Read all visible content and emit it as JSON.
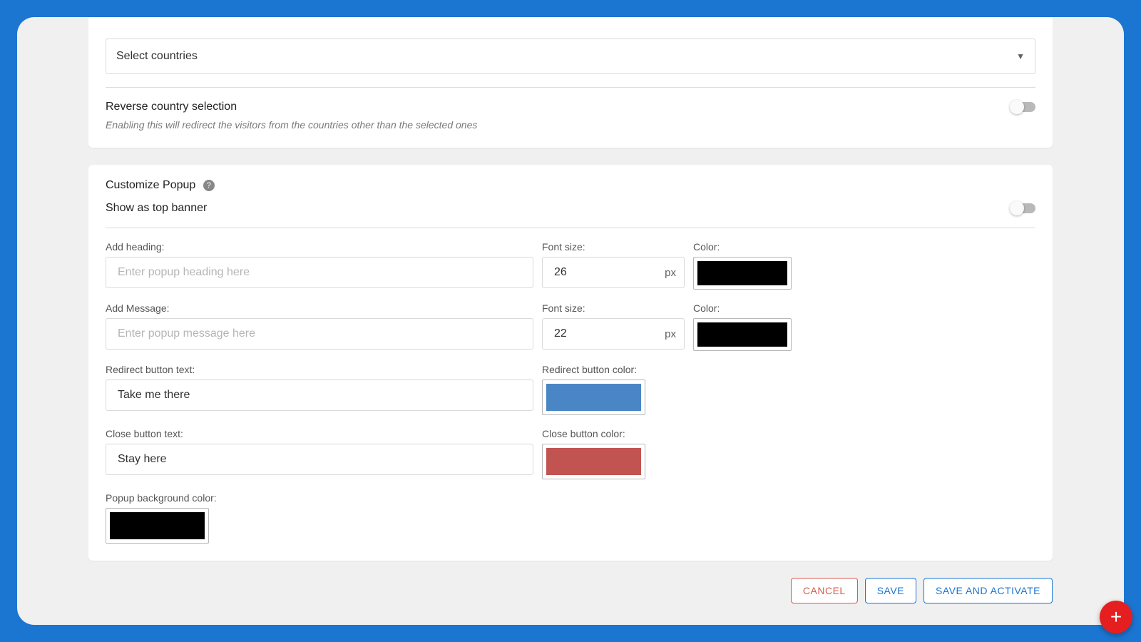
{
  "countrySelect": {
    "placeholder": "Select countries"
  },
  "reverse": {
    "title": "Reverse country selection",
    "hint": "Enabling this will redirect the visitors from the countries other than the selected ones"
  },
  "customize": {
    "title": "Customize Popup",
    "showTopBanner": "Show as top banner"
  },
  "fields": {
    "headingLabel": "Add heading:",
    "headingPlaceholder": "Enter popup heading here",
    "headingFontLabel": "Font size:",
    "headingFontValue": "26",
    "headingColorLabel": "Color:",
    "headingColor": "#000000",
    "messageLabel": "Add Message:",
    "messagePlaceholder": "Enter popup message here",
    "messageFontLabel": "Font size:",
    "messageFontValue": "22",
    "messageColorLabel": "Color:",
    "messageColor": "#000000",
    "redirectTextLabel": "Redirect button text:",
    "redirectTextValue": "Take me there",
    "redirectColorLabel": "Redirect button color:",
    "redirectColor": "#4a86c5",
    "closeTextLabel": "Close button text:",
    "closeTextValue": "Stay here",
    "closeColorLabel": "Close button color:",
    "closeColor": "#c15451",
    "popupBgLabel": "Popup background color:",
    "popupBgColor": "#000000",
    "pxSuffix": "px"
  },
  "buttons": {
    "cancel": "CANCEL",
    "save": "SAVE",
    "saveActivate": "SAVE AND ACTIVATE"
  }
}
